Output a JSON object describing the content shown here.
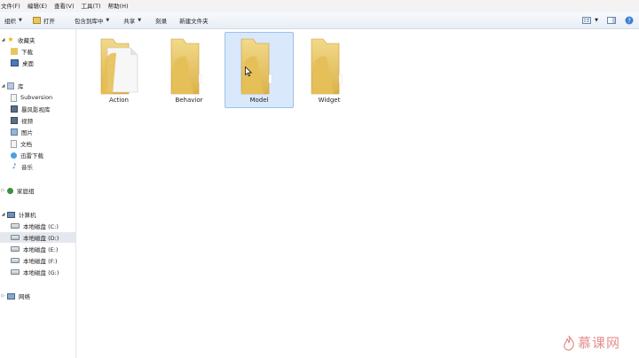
{
  "menubar": {
    "items": [
      "文件(F)",
      "编辑(E)",
      "查看(V)",
      "工具(T)",
      "帮助(H)"
    ]
  },
  "toolbar": {
    "organize": "组织",
    "open": "打开",
    "include_in_library": "包含到库中",
    "share": "共享",
    "burn": "刻录",
    "new_folder": "新建文件夹"
  },
  "nav": {
    "favorites": {
      "label": "收藏夹",
      "items": [
        "下载",
        "桌面"
      ]
    },
    "libraries": {
      "label": "库",
      "items": [
        "Subversion",
        "暴风影视库",
        "视频",
        "图片",
        "文档",
        "迅雷下载",
        "音乐"
      ]
    },
    "homegroup": "家庭组",
    "computer": {
      "label": "计算机",
      "drives": [
        "本地磁盘 (C:)",
        "本地磁盘 (D:)",
        "本地磁盘 (E:)",
        "本地磁盘 (F:)",
        "本地磁盘 (G:)"
      ]
    },
    "network": "网络"
  },
  "content": {
    "folders": [
      {
        "name": "Action",
        "selected": false
      },
      {
        "name": "Behavior",
        "selected": false
      },
      {
        "name": "Model",
        "selected": true
      },
      {
        "name": "Widget",
        "selected": false
      }
    ]
  },
  "watermark": {
    "text": "慕课网"
  },
  "colors": {
    "folder": "#e9c660",
    "selection": "#d9e8fb",
    "watermark": "#e07a7a"
  }
}
